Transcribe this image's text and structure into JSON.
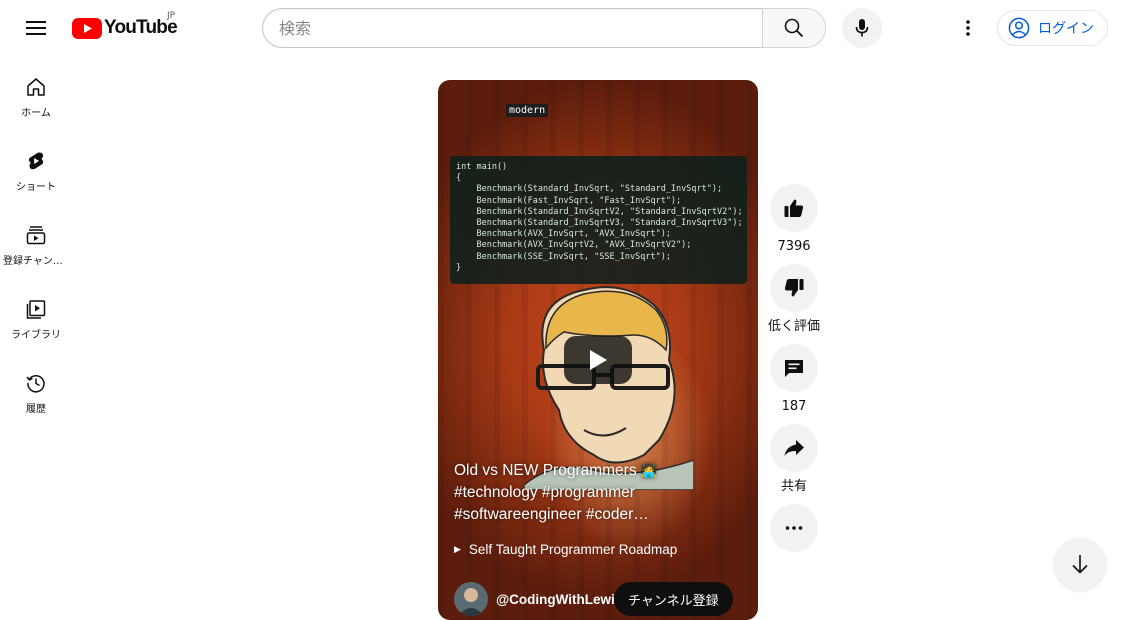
{
  "header": {
    "logo_text": "YouTube",
    "country_code": "JP",
    "search_placeholder": "検索",
    "login_label": "ログイン"
  },
  "sidebar": {
    "items": [
      {
        "label": "ホーム",
        "icon": "home-icon"
      },
      {
        "label": "ショート",
        "icon": "shorts-icon"
      },
      {
        "label": "登録チャンネル",
        "icon": "subscriptions-icon"
      },
      {
        "label": "ライブラリ",
        "icon": "library-icon"
      },
      {
        "label": "履歴",
        "icon": "history-icon"
      }
    ]
  },
  "video": {
    "overlay_tag": "modern",
    "code_lines": [
      "int main()",
      "{",
      "    Benchmark(Standard_InvSqrt, \"Standard_InvSqrt\");",
      "    Benchmark(Fast_InvSqrt, \"Fast_InvSqrt\");",
      "    Benchmark(Standard_InvSqrtV2, \"Standard_InvSqrtV2\");",
      "    Benchmark(Standard_InvSqrtV3, \"Standard_InvSqrtV3\");",
      "    Benchmark(AVX_InvSqrt, \"AVX_InvSqrt\");",
      "    Benchmark(AVX_InvSqrtV2, \"AVX_InvSqrtV2\");",
      "    Benchmark(SSE_InvSqrt, \"SSE_InvSqrt\");",
      "}"
    ],
    "title_line1": "Old vs NEW Programmers",
    "title_emoji": "🧑‍💻",
    "title_line2": "#technology #programmer",
    "title_line3": "#softwareengineer #coder…",
    "playlist_label": "Self Taught Programmer Roadmap",
    "channel_name": "@CodingWithLewi",
    "subscribe_label": "チャンネル登録"
  },
  "actions": {
    "like_count": "7396",
    "dislike_label": "低く評価",
    "comment_count": "187",
    "share_label": "共有"
  },
  "colors": {
    "brand_red": "#ff0000",
    "link_blue": "#065fd4",
    "chip_gray": "#f2f2f2"
  }
}
